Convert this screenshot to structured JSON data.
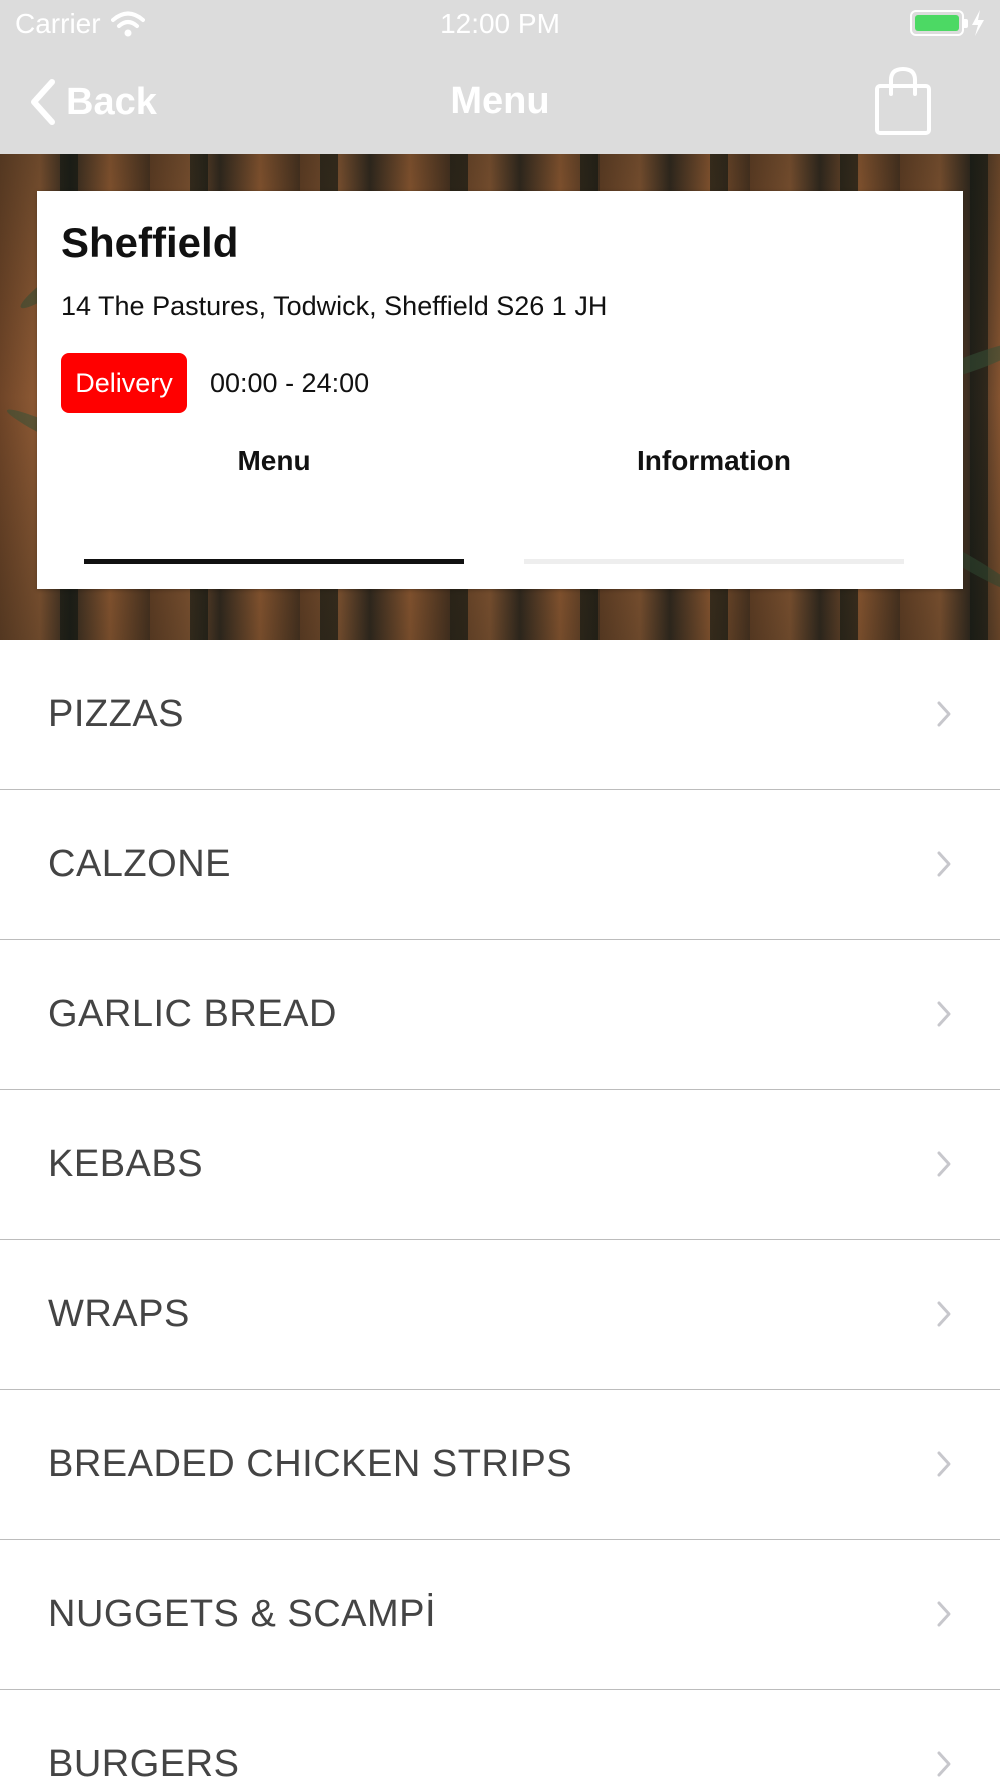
{
  "status_bar": {
    "carrier": "Carrier",
    "time": "12:00 PM",
    "battery_color": "#4cd964"
  },
  "nav": {
    "back_label": "Back",
    "title": "Menu",
    "cart_icon": "shopping-bag-icon"
  },
  "store": {
    "name": "Sheffield",
    "address": "14 The Pastures, Todwick, Sheffield S26 1 JH",
    "badge": "Delivery",
    "badge_color": "#ff0000",
    "hours": "00:00 - 24:00"
  },
  "tabs": [
    {
      "label": "Menu",
      "active": true
    },
    {
      "label": "Information",
      "active": false
    }
  ],
  "categories": [
    {
      "label": "PIZZAS"
    },
    {
      "label": "CALZONE"
    },
    {
      "label": "GARLIC BREAD"
    },
    {
      "label": "KEBABS"
    },
    {
      "label": "WRAPS"
    },
    {
      "label": "BREADED CHICKEN STRIPS"
    },
    {
      "label": "NUGGETS & SCAMPİ"
    },
    {
      "label": "BURGERS"
    }
  ]
}
